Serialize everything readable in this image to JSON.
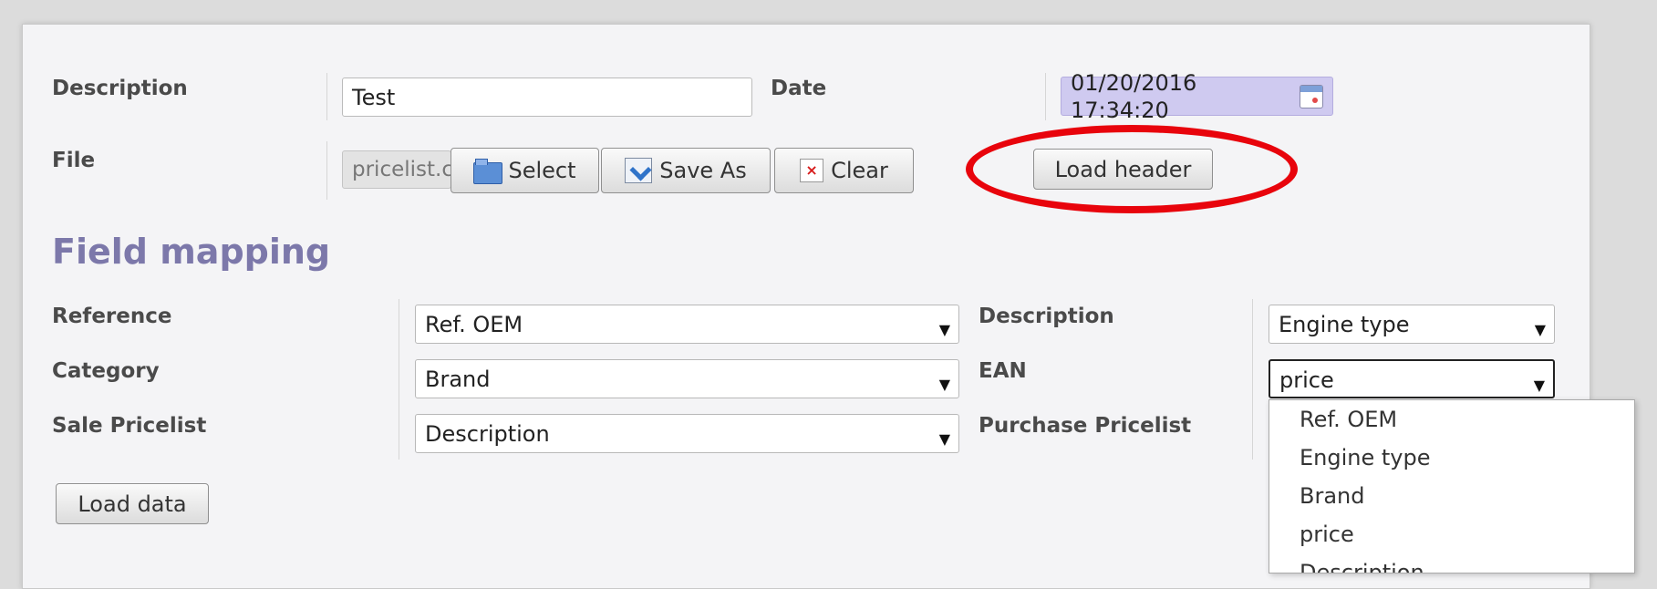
{
  "form": {
    "description_label": "Description",
    "description_value": "Test",
    "date_label": "Date",
    "date_value": "01/20/2016 17:34:20",
    "file_label": "File",
    "file_value": "pricelist.c"
  },
  "buttons": {
    "select": "Select",
    "save_as": "Save As",
    "clear": "Clear",
    "load_header": "Load header",
    "load_data": "Load data"
  },
  "field_mapping": {
    "heading": "Field mapping",
    "reference_label": "Reference",
    "reference_value": "Ref. OEM",
    "description_label": "Description",
    "description_value": "Engine type",
    "category_label": "Category",
    "category_value": "Brand",
    "ean_label": "EAN",
    "ean_value": "price",
    "sale_pricelist_label": "Sale Pricelist",
    "sale_pricelist_value": "Description",
    "purchase_pricelist_label": "Purchase Pricelist"
  },
  "dropdown_options": [
    "Ref. OEM",
    "Engine type",
    "Brand",
    "price",
    "Description"
  ],
  "colors": {
    "heading": "#7c78aa",
    "highlight": "#e8040c",
    "date_bg": "#cfcaf0"
  },
  "icons": {
    "select": "folder-icon",
    "save_as": "save-as-icon",
    "clear": "clear-icon",
    "date": "calendar-icon"
  }
}
